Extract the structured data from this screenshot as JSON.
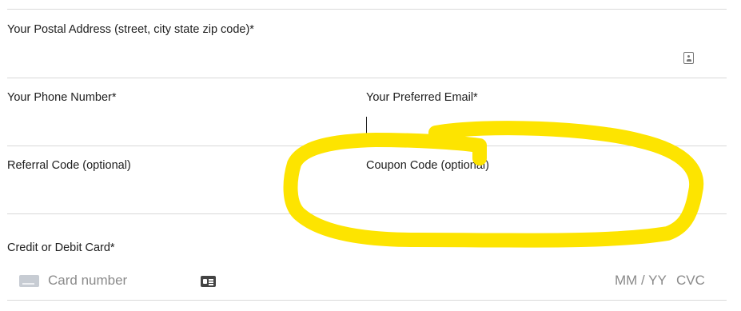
{
  "form": {
    "address": {
      "label": "Your Postal Address (street, city state zip code)*",
      "value": ""
    },
    "phone": {
      "label": "Your Phone Number*",
      "value": ""
    },
    "email": {
      "label": "Your Preferred Email*",
      "value": ""
    },
    "referral": {
      "label": "Referral Code (optional)",
      "value": ""
    },
    "coupon": {
      "label": "Coupon Code (optional)",
      "value": ""
    },
    "card": {
      "label": "Credit or Debit Card*",
      "number_placeholder": "Card number",
      "expiry_placeholder": "MM / YY",
      "cvc_placeholder": "CVC"
    }
  },
  "annotation": {
    "color": "#fde400"
  },
  "icons": [
    "contact-autofill-icon",
    "credit-card-icon",
    "contact-card-icon"
  ]
}
